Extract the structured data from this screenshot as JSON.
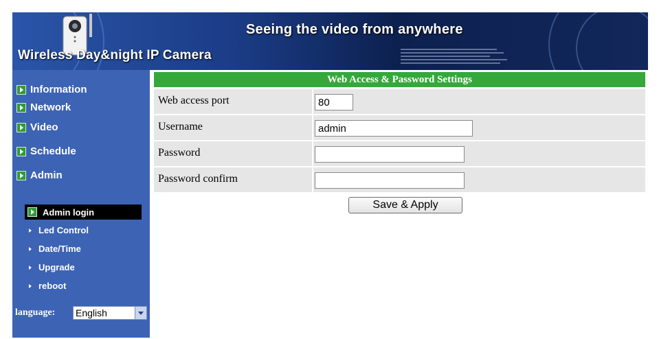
{
  "header": {
    "product_title": "Wireless Day&night IP Camera",
    "slogan": "Seeing the video from anywhere"
  },
  "sidebar": {
    "main_items": [
      {
        "label": "Information"
      },
      {
        "label": "Network"
      },
      {
        "label": "Video"
      },
      {
        "label": "Schedule"
      },
      {
        "label": "Admin"
      }
    ],
    "sub_items": [
      {
        "label": "Admin login",
        "active": true
      },
      {
        "label": "Led Control"
      },
      {
        "label": "Date/Time"
      },
      {
        "label": "Upgrade"
      },
      {
        "label": "reboot"
      }
    ],
    "language_label": "language:",
    "language_value": "English"
  },
  "panel": {
    "title": "Web Access & Password Settings",
    "fields": [
      {
        "label": "Web access port",
        "value": "80"
      },
      {
        "label": "Username",
        "value": "admin"
      },
      {
        "label": "Password",
        "value": ""
      },
      {
        "label": "Password confirm",
        "value": ""
      }
    ],
    "save_label": "Save & Apply"
  },
  "colors": {
    "sidebar_bg": "#3d63b4",
    "header_green": "#34a83b",
    "row_gray": "#e6e6e6",
    "active_bg": "#000000"
  },
  "icons": {
    "nav_bullet": "green-arrow-box-icon",
    "sub_bullet": "small-triangle-icon",
    "dropdown": "chevron-down-icon",
    "logo": "camera-icon"
  }
}
